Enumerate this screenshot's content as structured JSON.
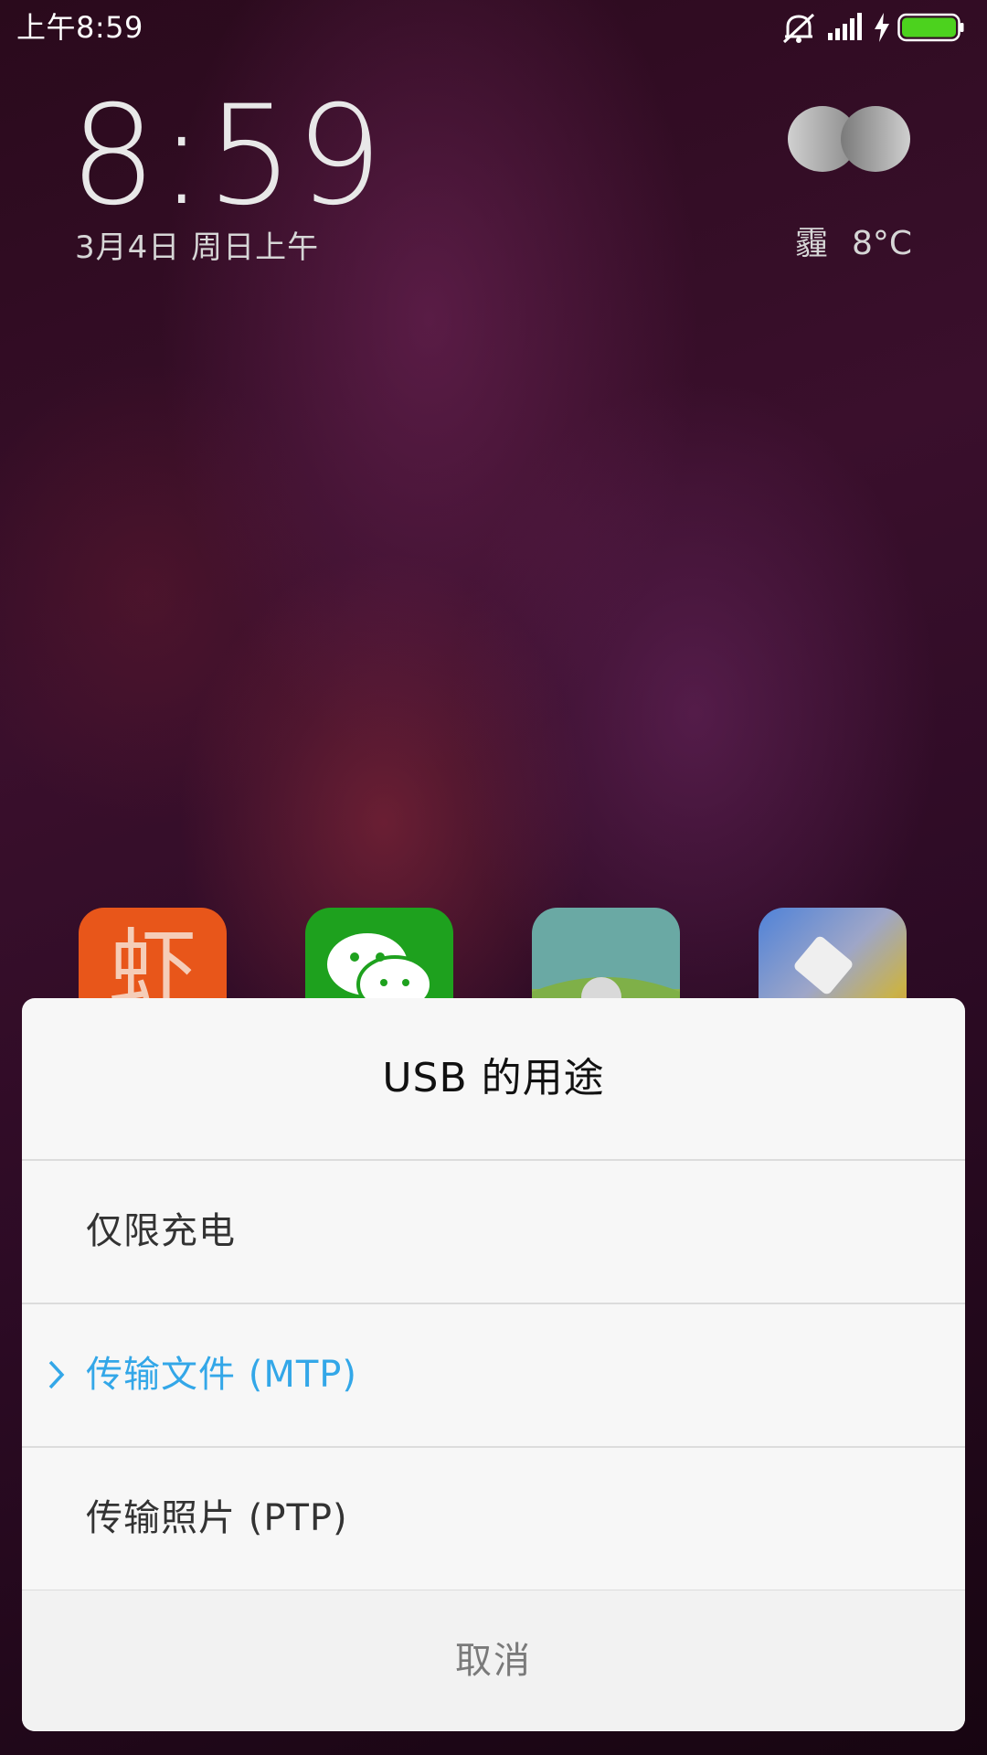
{
  "status_bar": {
    "time": "上午8:59",
    "icons": [
      "alarm-off-icon",
      "signal-icon",
      "charging-icon",
      "battery-icon"
    ],
    "battery_color": "#4cd21e"
  },
  "lockscreen": {
    "clock": "8:59",
    "date": "3月4日 周日上午",
    "weather": {
      "icon": "haze-icon",
      "condition": "霾",
      "temperature": "8°C"
    }
  },
  "apps": [
    {
      "icon": "xiami-music-icon",
      "color": "#e8561a",
      "glyph": "虾"
    },
    {
      "icon": "wechat-icon",
      "color": "#1ea11e"
    },
    {
      "icon": "gallery-icon",
      "color": "#6aa9a4"
    },
    {
      "icon": "themes-icon",
      "color": "#7f8fd0"
    }
  ],
  "dialog": {
    "title": "USB 的用途",
    "options": [
      {
        "label": "仅限充电",
        "selected": false
      },
      {
        "label": "传输文件 (MTP)",
        "selected": true
      },
      {
        "label": "传输照片 (PTP)",
        "selected": false
      }
    ],
    "cancel_label": "取消",
    "accent_color": "#33a7e8"
  }
}
